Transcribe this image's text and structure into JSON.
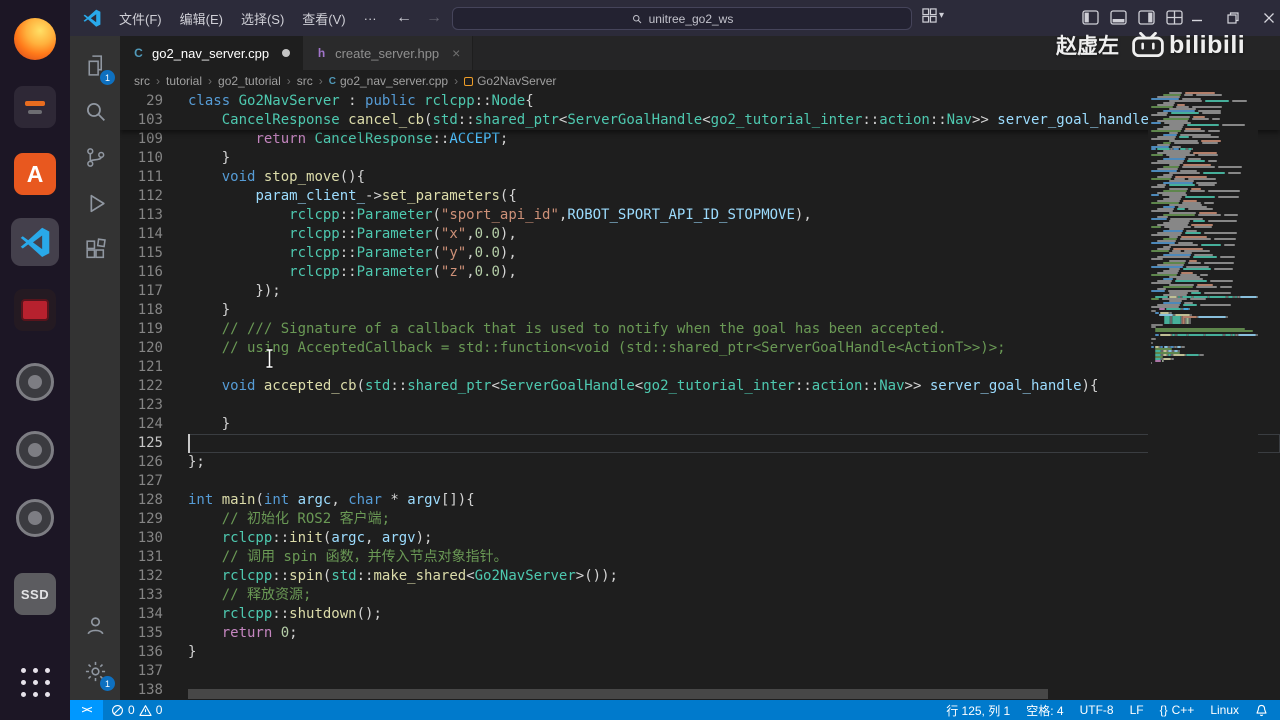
{
  "dock": {
    "software_letter": "A",
    "ssd_label": "SSD"
  },
  "icons": {
    "back": "←",
    "forward": "→",
    "chevron_down": "▾",
    "close": "×"
  },
  "titlebar": {
    "menus": [
      "文件(F)",
      "编辑(E)",
      "选择(S)",
      "查看(V)",
      "···"
    ],
    "search_text": "unitree_go2_ws"
  },
  "watermark": {
    "name": "赵虚左",
    "brand": "bilibili"
  },
  "tabs": [
    {
      "label": "go2_nav_server.cpp",
      "icon_text": "C",
      "icon_color": "#519aba",
      "active": true,
      "modified": true
    },
    {
      "label": "create_server.hpp",
      "icon_text": "h",
      "icon_color": "#a074c9",
      "active": false,
      "modified": false
    }
  ],
  "breadcrumb": {
    "separator": "›",
    "items": [
      {
        "label": "src"
      },
      {
        "label": "tutorial"
      },
      {
        "label": "go2_tutorial"
      },
      {
        "label": "src"
      },
      {
        "label": "go2_nav_server.cpp",
        "icon": "cpp-file"
      },
      {
        "label": "Go2NavServer",
        "icon": "class-symbol"
      }
    ]
  },
  "activitybar": {
    "explorer_badge": "1",
    "settings_badge": "1"
  },
  "editor": {
    "cursor": {
      "line": 125,
      "col": 1
    },
    "sticky_lines": [
      {
        "n": 29,
        "t": [
          [
            "kw",
            "class"
          ],
          [
            "pun",
            " "
          ],
          [
            "type",
            "Go2NavServer"
          ],
          [
            "pun",
            " : "
          ],
          [
            "kw",
            "public"
          ],
          [
            "pun",
            " "
          ],
          [
            "type",
            "rclcpp"
          ],
          [
            "pun",
            "::"
          ],
          [
            "type",
            "Node"
          ],
          [
            "pun",
            "{"
          ]
        ]
      },
      {
        "n": 103,
        "t": [
          [
            "pun",
            "    "
          ],
          [
            "type",
            "CancelResponse"
          ],
          [
            "pun",
            " "
          ],
          [
            "fn",
            "cancel_cb"
          ],
          [
            "pun",
            "("
          ],
          [
            "type",
            "std"
          ],
          [
            "pun",
            "::"
          ],
          [
            "type",
            "shared_ptr"
          ],
          [
            "pun",
            "<"
          ],
          [
            "type",
            "ServerGoalHandle"
          ],
          [
            "pun",
            "<"
          ],
          [
            "type",
            "go2_tutorial_inter"
          ],
          [
            "pun",
            "::"
          ],
          [
            "type",
            "action"
          ],
          [
            "pun",
            "::"
          ],
          [
            "type",
            "Nav"
          ],
          [
            "pun",
            ">> "
          ],
          [
            "var",
            "server_goal_handle"
          ],
          [
            "pun",
            ")"
          ]
        ]
      }
    ],
    "lines": [
      {
        "n": 109,
        "t": [
          [
            "pun",
            "        "
          ],
          [
            "ctl",
            "return"
          ],
          [
            "pun",
            " "
          ],
          [
            "type",
            "CancelResponse"
          ],
          [
            "pun",
            "::"
          ],
          [
            "const",
            "ACCEPT"
          ],
          [
            "pun",
            ";"
          ]
        ]
      },
      {
        "n": 110,
        "t": [
          [
            "pun",
            "    }"
          ]
        ]
      },
      {
        "n": 111,
        "t": [
          [
            "pun",
            "    "
          ],
          [
            "kw",
            "void"
          ],
          [
            "pun",
            " "
          ],
          [
            "fn",
            "stop_move"
          ],
          [
            "pun",
            "(){"
          ]
        ]
      },
      {
        "n": 112,
        "t": [
          [
            "pun",
            "        "
          ],
          [
            "var",
            "param_client_"
          ],
          [
            "pun",
            "->"
          ],
          [
            "fn",
            "set_parameters"
          ],
          [
            "pun",
            "({"
          ]
        ]
      },
      {
        "n": 113,
        "t": [
          [
            "pun",
            "            "
          ],
          [
            "type",
            "rclcpp"
          ],
          [
            "pun",
            "::"
          ],
          [
            "type",
            "Parameter"
          ],
          [
            "pun",
            "("
          ],
          [
            "str",
            "\"sport_api_id\""
          ],
          [
            "pun",
            ","
          ],
          [
            "var",
            "ROBOT_SPORT_API_ID_STOPMOVE"
          ],
          [
            "pun",
            "),"
          ]
        ]
      },
      {
        "n": 114,
        "t": [
          [
            "pun",
            "            "
          ],
          [
            "type",
            "rclcpp"
          ],
          [
            "pun",
            "::"
          ],
          [
            "type",
            "Parameter"
          ],
          [
            "pun",
            "("
          ],
          [
            "str",
            "\"x\""
          ],
          [
            "pun",
            ","
          ],
          [
            "num",
            "0.0"
          ],
          [
            "pun",
            "),"
          ]
        ]
      },
      {
        "n": 115,
        "t": [
          [
            "pun",
            "            "
          ],
          [
            "type",
            "rclcpp"
          ],
          [
            "pun",
            "::"
          ],
          [
            "type",
            "Parameter"
          ],
          [
            "pun",
            "("
          ],
          [
            "str",
            "\"y\""
          ],
          [
            "pun",
            ","
          ],
          [
            "num",
            "0.0"
          ],
          [
            "pun",
            "),"
          ]
        ]
      },
      {
        "n": 116,
        "t": [
          [
            "pun",
            "            "
          ],
          [
            "type",
            "rclcpp"
          ],
          [
            "pun",
            "::"
          ],
          [
            "type",
            "Parameter"
          ],
          [
            "pun",
            "("
          ],
          [
            "str",
            "\"z\""
          ],
          [
            "pun",
            ","
          ],
          [
            "num",
            "0.0"
          ],
          [
            "pun",
            "),"
          ]
        ]
      },
      {
        "n": 117,
        "t": [
          [
            "pun",
            "        });"
          ]
        ]
      },
      {
        "n": 118,
        "t": [
          [
            "pun",
            "    }"
          ]
        ]
      },
      {
        "n": 119,
        "t": [
          [
            "pun",
            "    "
          ],
          [
            "cmt",
            "// /// Signature of a callback that is used to notify when the goal has been accepted."
          ]
        ]
      },
      {
        "n": 120,
        "t": [
          [
            "pun",
            "    "
          ],
          [
            "cmt",
            "// using AcceptedCallback = std::function<void (std::shared_ptr<ServerGoalHandle<ActionT>>)>;"
          ]
        ]
      },
      {
        "n": 121,
        "t": []
      },
      {
        "n": 122,
        "t": [
          [
            "pun",
            "    "
          ],
          [
            "kw",
            "void"
          ],
          [
            "pun",
            " "
          ],
          [
            "fn",
            "accepted_cb"
          ],
          [
            "pun",
            "("
          ],
          [
            "type",
            "std"
          ],
          [
            "pun",
            "::"
          ],
          [
            "type",
            "shared_ptr"
          ],
          [
            "pun",
            "<"
          ],
          [
            "type",
            "ServerGoalHandle"
          ],
          [
            "pun",
            "<"
          ],
          [
            "type",
            "go2_tutorial_inter"
          ],
          [
            "pun",
            "::"
          ],
          [
            "type",
            "action"
          ],
          [
            "pun",
            "::"
          ],
          [
            "type",
            "Nav"
          ],
          [
            "pun",
            ">> "
          ],
          [
            "var",
            "server_goal_handle"
          ],
          [
            "pun",
            "){"
          ]
        ]
      },
      {
        "n": 123,
        "t": []
      },
      {
        "n": 124,
        "t": [
          [
            "pun",
            "    }"
          ]
        ]
      },
      {
        "n": 125,
        "t": []
      },
      {
        "n": 126,
        "t": [
          [
            "pun",
            "};"
          ]
        ]
      },
      {
        "n": 127,
        "t": []
      },
      {
        "n": 128,
        "t": [
          [
            "kw",
            "int"
          ],
          [
            "pun",
            " "
          ],
          [
            "fn",
            "main"
          ],
          [
            "pun",
            "("
          ],
          [
            "kw",
            "int"
          ],
          [
            "pun",
            " "
          ],
          [
            "var",
            "argc"
          ],
          [
            "pun",
            ", "
          ],
          [
            "kw",
            "char"
          ],
          [
            "pun",
            " * "
          ],
          [
            "var",
            "argv"
          ],
          [
            "pun",
            "[]){"
          ]
        ]
      },
      {
        "n": 129,
        "t": [
          [
            "pun",
            "    "
          ],
          [
            "cmt",
            "// 初始化 ROS2 客户端;"
          ]
        ]
      },
      {
        "n": 130,
        "t": [
          [
            "pun",
            "    "
          ],
          [
            "type",
            "rclcpp"
          ],
          [
            "pun",
            "::"
          ],
          [
            "fn",
            "init"
          ],
          [
            "pun",
            "("
          ],
          [
            "var",
            "argc"
          ],
          [
            "pun",
            ", "
          ],
          [
            "var",
            "argv"
          ],
          [
            "pun",
            ");"
          ]
        ]
      },
      {
        "n": 131,
        "t": [
          [
            "pun",
            "    "
          ],
          [
            "cmt",
            "// 调用 spin 函数，并传入节点对象指针。"
          ]
        ]
      },
      {
        "n": 132,
        "t": [
          [
            "pun",
            "    "
          ],
          [
            "type",
            "rclcpp"
          ],
          [
            "pun",
            "::"
          ],
          [
            "fn",
            "spin"
          ],
          [
            "pun",
            "("
          ],
          [
            "type",
            "std"
          ],
          [
            "pun",
            "::"
          ],
          [
            "fn",
            "make_shared"
          ],
          [
            "pun",
            "<"
          ],
          [
            "type",
            "Go2NavServer"
          ],
          [
            "pun",
            ">());"
          ]
        ]
      },
      {
        "n": 133,
        "t": [
          [
            "pun",
            "    "
          ],
          [
            "cmt",
            "// 释放资源;"
          ]
        ]
      },
      {
        "n": 134,
        "t": [
          [
            "pun",
            "    "
          ],
          [
            "type",
            "rclcpp"
          ],
          [
            "pun",
            "::"
          ],
          [
            "fn",
            "shutdown"
          ],
          [
            "pun",
            "();"
          ]
        ]
      },
      {
        "n": 135,
        "t": [
          [
            "pun",
            "    "
          ],
          [
            "ctl",
            "return"
          ],
          [
            "pun",
            " "
          ],
          [
            "num",
            "0"
          ],
          [
            "pun",
            ";"
          ]
        ]
      },
      {
        "n": 136,
        "t": [
          [
            "pun",
            "}"
          ]
        ]
      },
      {
        "n": 137,
        "t": []
      },
      {
        "n": 138,
        "t": []
      }
    ]
  },
  "statusbar": {
    "remote_icon": "><",
    "errors": "0",
    "warnings": "0",
    "line_col": "行 125, 列 1",
    "spaces": "空格: 4",
    "encoding": "UTF-8",
    "eol": "LF",
    "lang_icon": "{}",
    "lang": "C++",
    "os": "Linux"
  },
  "colors": {
    "statusbar": "#007acc",
    "remote": "#0098ff",
    "editor_bg": "#1e1e1e",
    "accent_badge": "#0e70c0"
  }
}
